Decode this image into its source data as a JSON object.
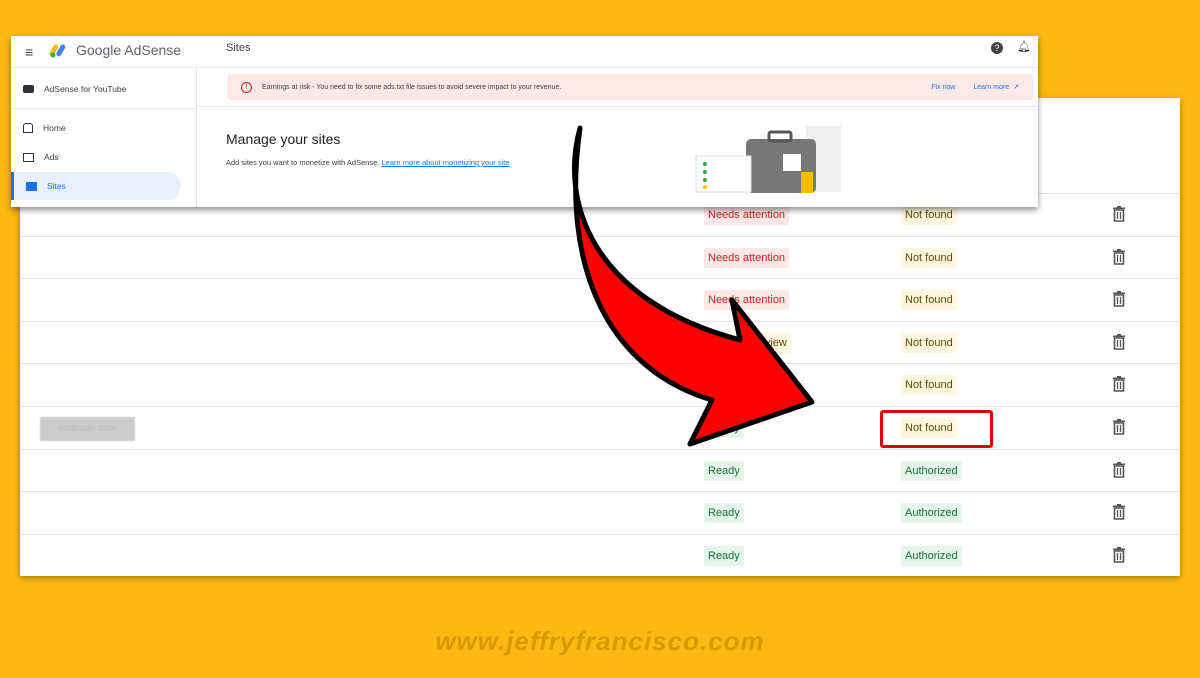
{
  "header": {
    "brand": "Google AdSense",
    "page_title": "Sites"
  },
  "sidebar": {
    "items": [
      {
        "label": "AdSense for YouTube",
        "icon": "youtube-icon"
      },
      {
        "label": "Home",
        "icon": "home-icon"
      },
      {
        "label": "Ads",
        "icon": "ads-icon"
      },
      {
        "label": "Sites",
        "icon": "sites-icon",
        "active": true
      }
    ]
  },
  "banner": {
    "text": "Earnings at risk - You need to fix some ads.txt file issues to avoid severe impact to your revenue.",
    "fix": "Fix now",
    "learn": "Learn more"
  },
  "manage": {
    "title": "Manage your sites",
    "desc": "Add sites you want to monetize with AdSense.",
    "link": "Learn more about monetizing your site"
  },
  "rows": [
    {
      "status": "Needs attention",
      "status_color": "red",
      "ads_txt": "Not found"
    },
    {
      "status": "Needs attention",
      "status_color": "red",
      "ads_txt": "Not found"
    },
    {
      "status": "Needs attention",
      "status_color": "red",
      "ads_txt": "Not found"
    },
    {
      "status": "Requires review",
      "status_color": "yellow",
      "ads_txt": "Not found"
    },
    {
      "status": "",
      "status_color": "",
      "ads_txt": "Not found"
    },
    {
      "status": "Ready",
      "status_color": "green",
      "ads_txt": "Not found",
      "site": "example.com",
      "highlighted": true
    },
    {
      "status": "Ready",
      "status_color": "green",
      "ads_txt": "Authorized"
    },
    {
      "status": "Ready",
      "status_color": "green",
      "ads_txt": "Authorized"
    },
    {
      "status": "Ready",
      "status_color": "green",
      "ads_txt": "Authorized"
    }
  ],
  "watermark": "www.jeffryfrancisco.com",
  "colors": {
    "background": "#fdb813",
    "arrow": "#ff0000",
    "highlight": "#e00000"
  }
}
